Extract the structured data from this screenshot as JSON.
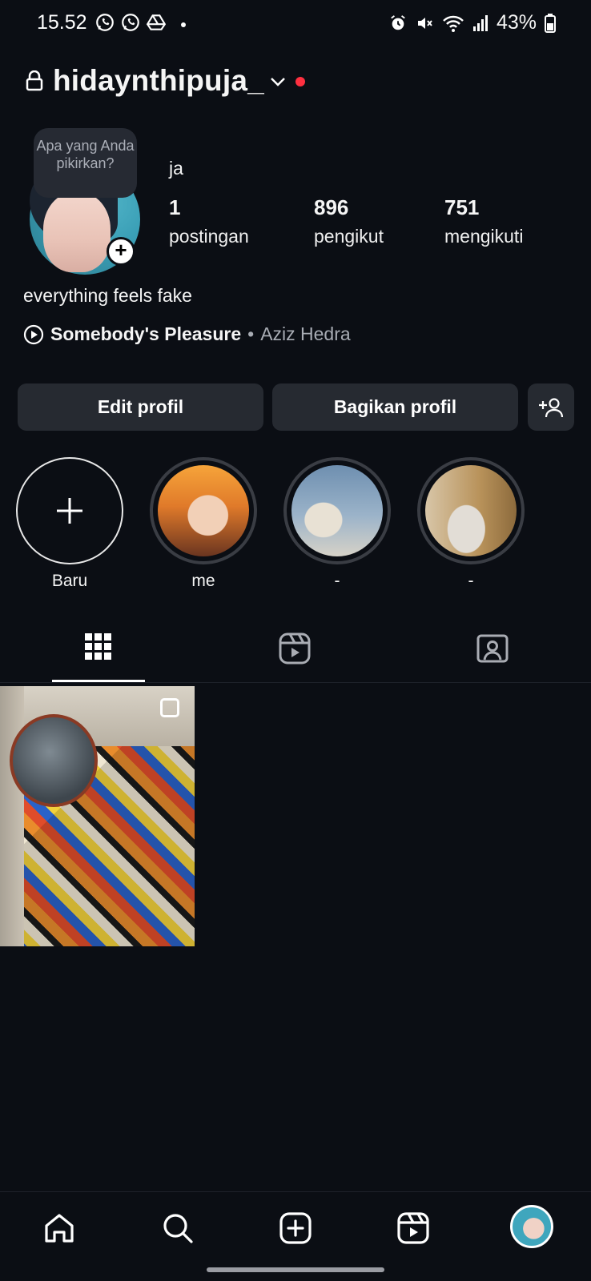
{
  "status_bar": {
    "time": "15.52",
    "battery": "43%",
    "icons": [
      "whatsapp-icon",
      "whatsapp-icon",
      "drive-icon",
      "alarm-icon",
      "mute-icon",
      "wifi-icon",
      "signal-icon",
      "battery-icon"
    ]
  },
  "header": {
    "username": "hidaynthipuja_"
  },
  "profile": {
    "note_bubble": "Apa yang Anda pikirkan?",
    "name": "ja",
    "stats": [
      {
        "value": "1",
        "label": "postingan"
      },
      {
        "value": "896",
        "label": "pengikut"
      },
      {
        "value": "751",
        "label": "mengikuti"
      }
    ],
    "bio": "everything feels fake",
    "music": {
      "song": "Somebody's Pleasure",
      "separator": "•",
      "artist": "Aziz Hedra"
    }
  },
  "actions": {
    "edit": "Edit profil",
    "share": "Bagikan profil"
  },
  "highlights": [
    {
      "label": "Baru"
    },
    {
      "label": "me"
    },
    {
      "label": "-"
    },
    {
      "label": "-"
    }
  ],
  "tabs": [
    "grid-icon",
    "reels-icon",
    "tagged-icon"
  ],
  "nav": [
    "home-icon",
    "search-icon",
    "create-icon",
    "reels-icon",
    "profile-avatar"
  ],
  "colors": {
    "background": "#0b0e14",
    "button": "#262a31",
    "notification_dot": "#ff3040"
  }
}
